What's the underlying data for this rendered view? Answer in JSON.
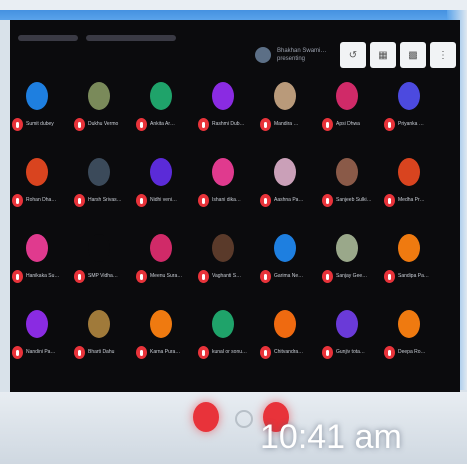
{
  "meeting": {
    "presenter_name": "Bhakhan Swami…",
    "presenter_sub": "presenting",
    "clock": "10:41 am"
  },
  "toolbar_icons": [
    "pin-icon",
    "layout-icon",
    "chat-icon",
    "more-icon"
  ],
  "participants": [
    {
      "name": "Sumit dubey",
      "color": "#1e7fe0"
    },
    {
      "name": "Dukhu Vermo",
      "color": "#7a8a5a"
    },
    {
      "name": "Ankita Ar…",
      "color": "#1fa36a"
    },
    {
      "name": "Rashmi Dub…",
      "color": "#8a2be2"
    },
    {
      "name": "Mandira …",
      "color": "#b99a7a"
    },
    {
      "name": "Apsi Dhwa",
      "color": "#d02a68"
    },
    {
      "name": "Priyanka …",
      "color": "#4c4adf"
    },
    {
      "name": "Rohan Dha…",
      "color": "#d9441f"
    },
    {
      "name": "Harsh Srivas…",
      "color": "#3b4a5a"
    },
    {
      "name": "Nidhi veni…",
      "color": "#5b2bd8"
    },
    {
      "name": "Ishani dika…",
      "color": "#e03a8e"
    },
    {
      "name": "Aashna Pa…",
      "color": "#caa0b8"
    },
    {
      "name": "Sanjeeb Sulki…",
      "color": "#8a5a48"
    },
    {
      "name": "Medha Pr…",
      "color": "#d9441f"
    },
    {
      "name": "Hanikaka Su…",
      "color": "#e03a8e"
    },
    {
      "name": "SMP Vidha…",
      "color": "#0b0b0d"
    },
    {
      "name": "Meenu Sura…",
      "color": "#d02a68"
    },
    {
      "name": "Vaghanti S…",
      "color": "#5a3a2a"
    },
    {
      "name": "Garima Ne…",
      "color": "#1e7fe0"
    },
    {
      "name": "Sanjay Gee…",
      "color": "#9aa88a"
    },
    {
      "name": "Sandipa Pa…",
      "color": "#ef7a10"
    },
    {
      "name": "Nandini Pa…",
      "color": "#8a2be2"
    },
    {
      "name": "Bharti Dahu",
      "color": "#a07a3a"
    },
    {
      "name": "Karna Pura…",
      "color": "#ef7a10"
    },
    {
      "name": "kunal or sonu…",
      "color": "#1fa36a"
    },
    {
      "name": "Chitvandra…",
      "color": "#ef6a10"
    },
    {
      "name": "Gunjiv tota…",
      "color": "#6a3ad8"
    },
    {
      "name": "Deepa Ro…",
      "color": "#ef7a10"
    }
  ]
}
